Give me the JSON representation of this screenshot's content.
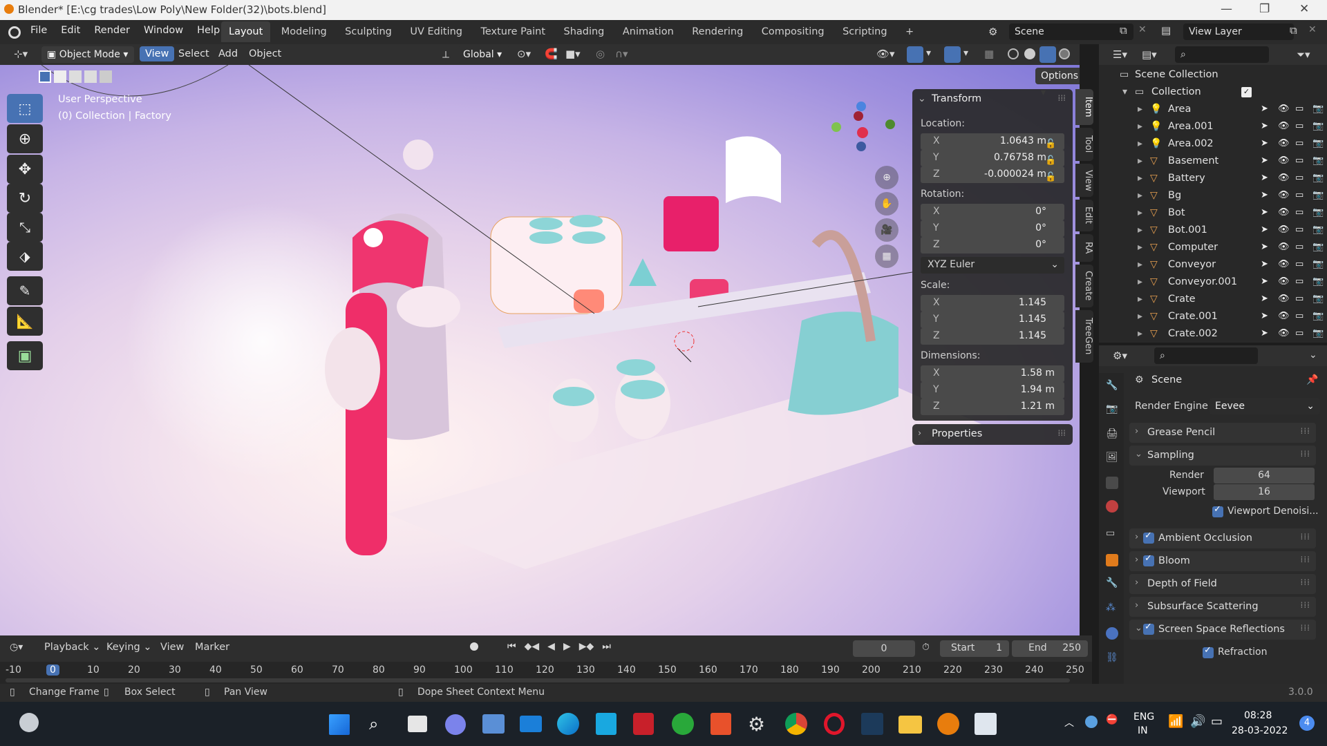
{
  "window": {
    "title": "Blender* [E:\\cg trades\\Low Poly\\New Folder(32)\\bots.blend]"
  },
  "menu": [
    "File",
    "Edit",
    "Render",
    "Window",
    "Help"
  ],
  "workspaces": [
    "Layout",
    "Modeling",
    "Sculpting",
    "UV Editing",
    "Texture Paint",
    "Shading",
    "Animation",
    "Rendering",
    "Compositing",
    "Scripting"
  ],
  "scene": {
    "name": "Scene",
    "view_layer": "View Layer"
  },
  "viewport_header": {
    "mode": "Object Mode",
    "view": "View",
    "select": "Select",
    "add": "Add",
    "object": "Object",
    "orientation": "Global",
    "options": "Options"
  },
  "viewport": {
    "perspective": "User Perspective",
    "collection": "(0) Collection | Factory"
  },
  "transform": {
    "title": "Transform",
    "location_label": "Location:",
    "location": [
      {
        "axis": "X",
        "value": "1.0643 m"
      },
      {
        "axis": "Y",
        "value": "0.76758 m"
      },
      {
        "axis": "Z",
        "value": "-0.000024 m"
      }
    ],
    "rotation_label": "Rotation:",
    "rotation": [
      {
        "axis": "X",
        "value": "0°"
      },
      {
        "axis": "Y",
        "value": "0°"
      },
      {
        "axis": "Z",
        "value": "0°"
      }
    ],
    "rotation_mode": "XYZ Euler",
    "scale_label": "Scale:",
    "scale": [
      {
        "axis": "X",
        "value": "1.145"
      },
      {
        "axis": "Y",
        "value": "1.145"
      },
      {
        "axis": "Z",
        "value": "1.145"
      }
    ],
    "dimensions_label": "Dimensions:",
    "dimensions": [
      {
        "axis": "X",
        "value": "1.58 m"
      },
      {
        "axis": "Y",
        "value": "1.94 m"
      },
      {
        "axis": "Z",
        "value": "1.21 m"
      }
    ],
    "properties": "Properties"
  },
  "side_tabs": [
    "Item",
    "Tool",
    "View",
    "Edit",
    "RA",
    "Create",
    "TreeGen"
  ],
  "outliner": {
    "scene_collection": "Scene Collection",
    "collection": "Collection",
    "items": [
      {
        "name": "Area",
        "type": "light"
      },
      {
        "name": "Area.001",
        "type": "light"
      },
      {
        "name": "Area.002",
        "type": "light"
      },
      {
        "name": "Basement",
        "type": "mesh"
      },
      {
        "name": "Battery",
        "type": "mesh"
      },
      {
        "name": "Bg",
        "type": "mesh"
      },
      {
        "name": "Bot",
        "type": "mesh"
      },
      {
        "name": "Bot.001",
        "type": "mesh"
      },
      {
        "name": "Computer",
        "type": "mesh"
      },
      {
        "name": "Conveyor",
        "type": "mesh"
      },
      {
        "name": "Conveyor.001",
        "type": "mesh"
      },
      {
        "name": "Crate",
        "type": "mesh"
      },
      {
        "name": "Crate.001",
        "type": "mesh"
      },
      {
        "name": "Crate.002",
        "type": "mesh"
      }
    ]
  },
  "properties": {
    "context": "Scene",
    "render_engine_label": "Render Engine",
    "render_engine": "Eevee",
    "sections": {
      "grease_pencil": "Grease Pencil",
      "sampling": "Sampling",
      "render_label": "Render",
      "render_value": "64",
      "viewport_label": "Viewport",
      "viewport_value": "16",
      "viewport_denoise": "Viewport Denoisi...",
      "ambient_occlusion": "Ambient Occlusion",
      "bloom": "Bloom",
      "depth_of_field": "Depth of Field",
      "subsurface": "Subsurface Scattering",
      "ssr": "Screen Space Reflections",
      "refraction": "Refraction"
    }
  },
  "timeline": {
    "playback": "Playback",
    "keying": "Keying",
    "view": "View",
    "marker": "Marker",
    "current_frame": "0",
    "start_label": "Start",
    "start": "1",
    "end_label": "End",
    "end": "250",
    "ruler": [
      "-10",
      "0",
      "10",
      "20",
      "30",
      "40",
      "50",
      "60",
      "70",
      "80",
      "90",
      "100",
      "110",
      "120",
      "130",
      "140",
      "150",
      "160",
      "170",
      "180",
      "190",
      "200",
      "210",
      "220",
      "230",
      "240",
      "250"
    ]
  },
  "status": {
    "change_frame": "Change Frame",
    "box_select": "Box Select",
    "pan_view": "Pan View",
    "context_menu": "Dope Sheet Context Menu",
    "version": "3.0.0"
  },
  "taskbar": {
    "lang": "ENG",
    "region": "IN",
    "time": "08:28",
    "date": "28-03-2022",
    "notifications": "4"
  },
  "colors": {
    "accent": "#4772b3",
    "header": "#303030",
    "panel": "#282828"
  }
}
